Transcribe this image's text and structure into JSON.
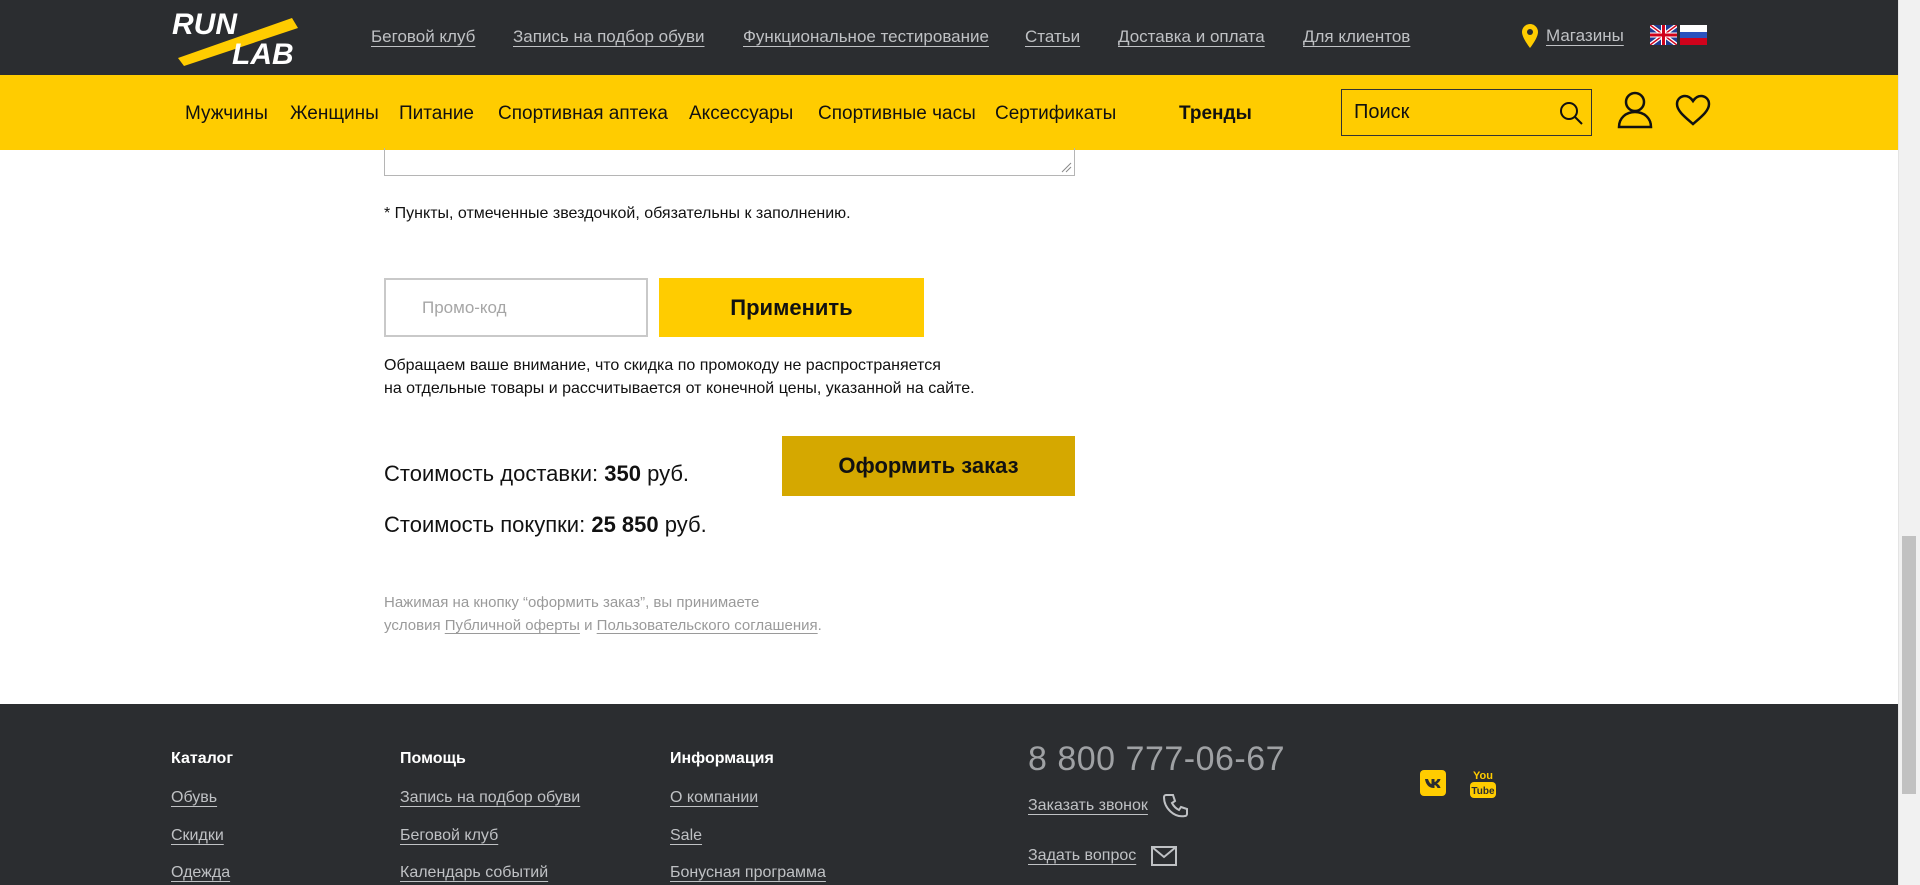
{
  "brand": {
    "logo_line1": "RUN",
    "logo_line2": "LAB"
  },
  "top_links": [
    "Беговой клуб",
    "Запись на подбор обуви",
    "Функциональное тестирование",
    "Статьи",
    "Доставка и оплата",
    "Для клиентов"
  ],
  "stores_label": "Магазины",
  "nav": {
    "items": [
      "Мужчины",
      "Женщины",
      "Питание",
      "Спортивная аптека",
      "Аксессуары",
      "Спортивные часы",
      "Сертификаты"
    ],
    "trends": "Тренды",
    "search_placeholder": "Поиск"
  },
  "form": {
    "required_note": "* Пункты, отмеченные звездочкой, обязательны к заполнению.",
    "promo_placeholder": "Промо-код",
    "apply_label": "Применить",
    "promo_disclaimer_line1": "Обращаем ваше внимание, что скидка по промокоду не распространяется",
    "promo_disclaimer_line2": "на отдельные товары и рассчитывается от конечной цены, указанной на сайте.",
    "delivery_label": "Стоимость доставки:",
    "delivery_value": "350",
    "purchase_label": "Стоимость покупки:",
    "purchase_value": "25 850",
    "currency": "руб.",
    "order_label": "Оформить заказ",
    "terms_line1": "Нажимая на кнопку “оформить заказ”, вы принимаете",
    "terms_prefix": "условия",
    "terms_link1": "Публичной оферты",
    "terms_and": "и",
    "terms_link2": "Пользовательского соглашения",
    "terms_end": "."
  },
  "footer": {
    "catalog": {
      "title": "Каталог",
      "links": [
        "Обувь",
        "Скидки",
        "Одежда"
      ]
    },
    "help": {
      "title": "Помощь",
      "links": [
        "Запись на подбор обуви",
        "Беговой клуб",
        "Календарь событий"
      ]
    },
    "info": {
      "title": "Информация",
      "links": [
        "О компании",
        "Sale",
        "Бонусная программа"
      ]
    },
    "phone": "8 800 777-06-67",
    "call_label": "Заказать звонок",
    "ask_label": "Задать вопрос",
    "social": {
      "vk": "vk-icon",
      "youtube_text": "You Tube"
    }
  },
  "colors": {
    "accent": "#ffcc00",
    "accent_dark": "#d5a800",
    "dark": "#2b2d30"
  }
}
